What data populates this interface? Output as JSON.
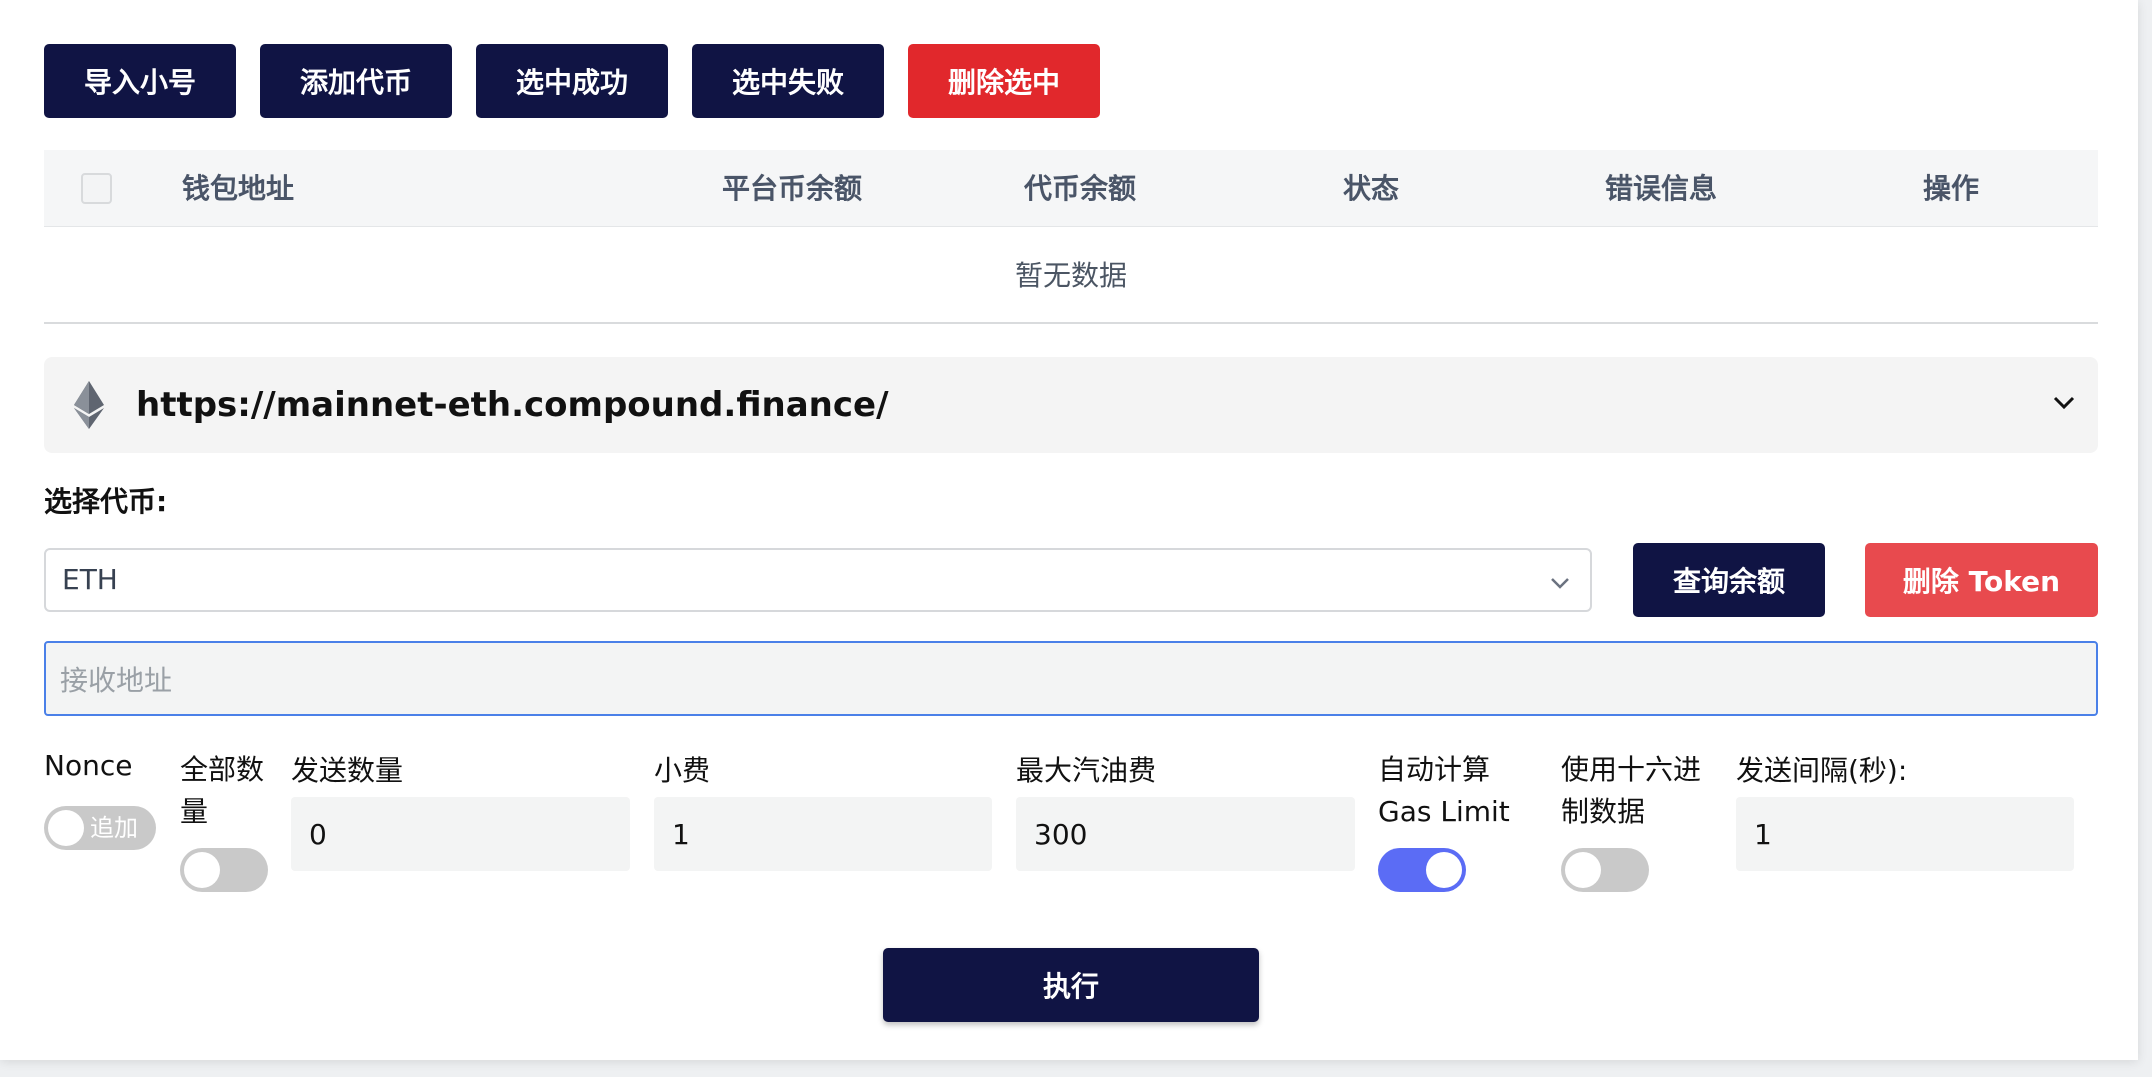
{
  "toolbar": {
    "import_label": "导入小号",
    "add_token_label": "添加代币",
    "select_success_label": "选中成功",
    "select_fail_label": "选中失败",
    "delete_selected_label": "删除选中"
  },
  "table": {
    "columns": [
      "钱包地址",
      "平台币余额",
      "代币余额",
      "状态",
      "错误信息",
      "操作"
    ],
    "empty_text": "暂无数据"
  },
  "rpc": {
    "url": "https://mainnet-eth.compound.finance/"
  },
  "token": {
    "label": "选择代币:",
    "selected": "ETH",
    "query_label": "查询余额",
    "delete_label": "删除 Token"
  },
  "receive": {
    "placeholder": "接收地址"
  },
  "settings": {
    "nonce_label": "Nonce",
    "nonce_toggle_text": "追加",
    "nonce_toggle_on": false,
    "all_amount_label": "全部数量",
    "all_amount_on": false,
    "send_amount_label": "发送数量",
    "send_amount_value": "0",
    "tip_label": "小费",
    "tip_value": "1",
    "max_gas_label": "最大汽油费",
    "max_gas_value": "300",
    "auto_gas_label": "自动计算Gas Limit",
    "auto_gas_on": true,
    "hex_label": "使用十六进制数据",
    "hex_on": false,
    "interval_label": "发送间隔(秒):",
    "interval_value": "1"
  },
  "execute_label": "执行",
  "colors": {
    "navy": "#101444",
    "red": "#e1282c",
    "toggle_on": "#5b6cf5",
    "focus_border": "#4a80e8"
  }
}
